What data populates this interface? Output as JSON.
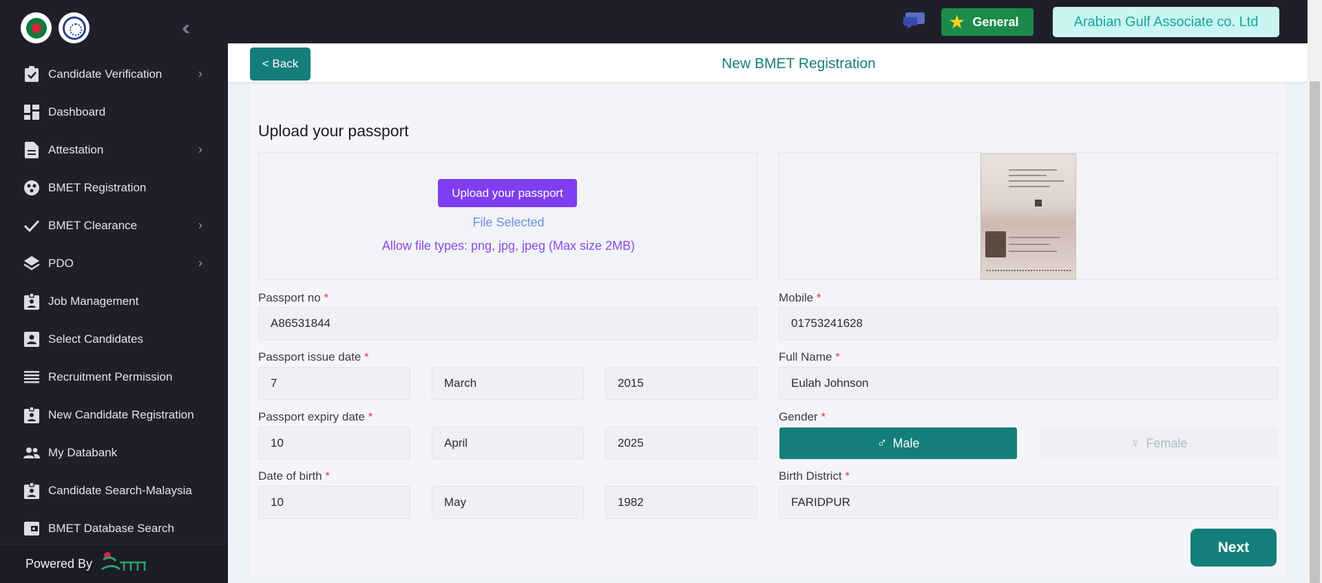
{
  "sidebar": {
    "collapse_icon": "double-chevron-left-icon",
    "items": [
      {
        "label": "Candidate Verification",
        "icon": "clipboard-check-icon",
        "has_arrow": true
      },
      {
        "label": "Dashboard",
        "icon": "dashboard-grid-icon",
        "has_arrow": false
      },
      {
        "label": "Attestation",
        "icon": "document-icon",
        "has_arrow": true
      },
      {
        "label": "BMET Registration",
        "icon": "registration-circle-icon",
        "has_arrow": false
      },
      {
        "label": "BMET Clearance",
        "icon": "checkmark-icon",
        "has_arrow": true
      },
      {
        "label": "PDO",
        "icon": "layers-icon",
        "has_arrow": true
      },
      {
        "label": "Job Management",
        "icon": "badge-icon",
        "has_arrow": false
      },
      {
        "label": "Select Candidates",
        "icon": "person-card-icon",
        "has_arrow": false
      },
      {
        "label": "Recruitment Permission",
        "icon": "list-lines-icon",
        "has_arrow": false
      },
      {
        "label": "New Candidate Registration",
        "icon": "badge-icon",
        "has_arrow": false
      },
      {
        "label": "My Databank",
        "icon": "people-icon",
        "has_arrow": false
      },
      {
        "label": "Candidate Search-Malaysia",
        "icon": "badge-icon",
        "has_arrow": false
      },
      {
        "label": "BMET Database Search",
        "icon": "wallet-icon",
        "has_arrow": false
      }
    ],
    "powered_by": "Powered By",
    "brand_logo": "ami-probashi-logo"
  },
  "topbar": {
    "general_label": "General",
    "company_label": "Arabian Gulf Associate co. Ltd"
  },
  "header": {
    "back_label": "< Back",
    "title": "New BMET Registration"
  },
  "form": {
    "section_title": "Upload your passport",
    "upload_button": "Upload your passport",
    "file_status": "File Selected",
    "allowed_types": "Allow file types: png, jpg, jpeg (Max size 2MB)",
    "passport_no": {
      "label": "Passport no",
      "value": "A86531844"
    },
    "mobile": {
      "label": "Mobile",
      "value": "01753241628"
    },
    "issue_date": {
      "label": "Passport issue date",
      "day": "7",
      "month": "March",
      "year": "2015"
    },
    "full_name": {
      "label": "Full Name",
      "value": "Eulah Johnson"
    },
    "expiry_date": {
      "label": "Passport expiry date",
      "day": "10",
      "month": "April",
      "year": "2025"
    },
    "gender": {
      "label": "Gender",
      "male": "Male",
      "female": "Female",
      "selected": "Male"
    },
    "dob": {
      "label": "Date of birth",
      "day": "10",
      "month": "May",
      "year": "1982"
    },
    "birth_district": {
      "label": "Birth District",
      "value": "FARIDPUR"
    },
    "required_mark": "*",
    "next_label": "Next"
  },
  "colors": {
    "sidebar_bg": "#1f1f2c",
    "primary_teal": "#147e7a",
    "upload_purple": "#7e3dee",
    "general_green": "#1b8a4a",
    "company_bg": "#c9f4f1",
    "required_red": "#e0393e"
  }
}
